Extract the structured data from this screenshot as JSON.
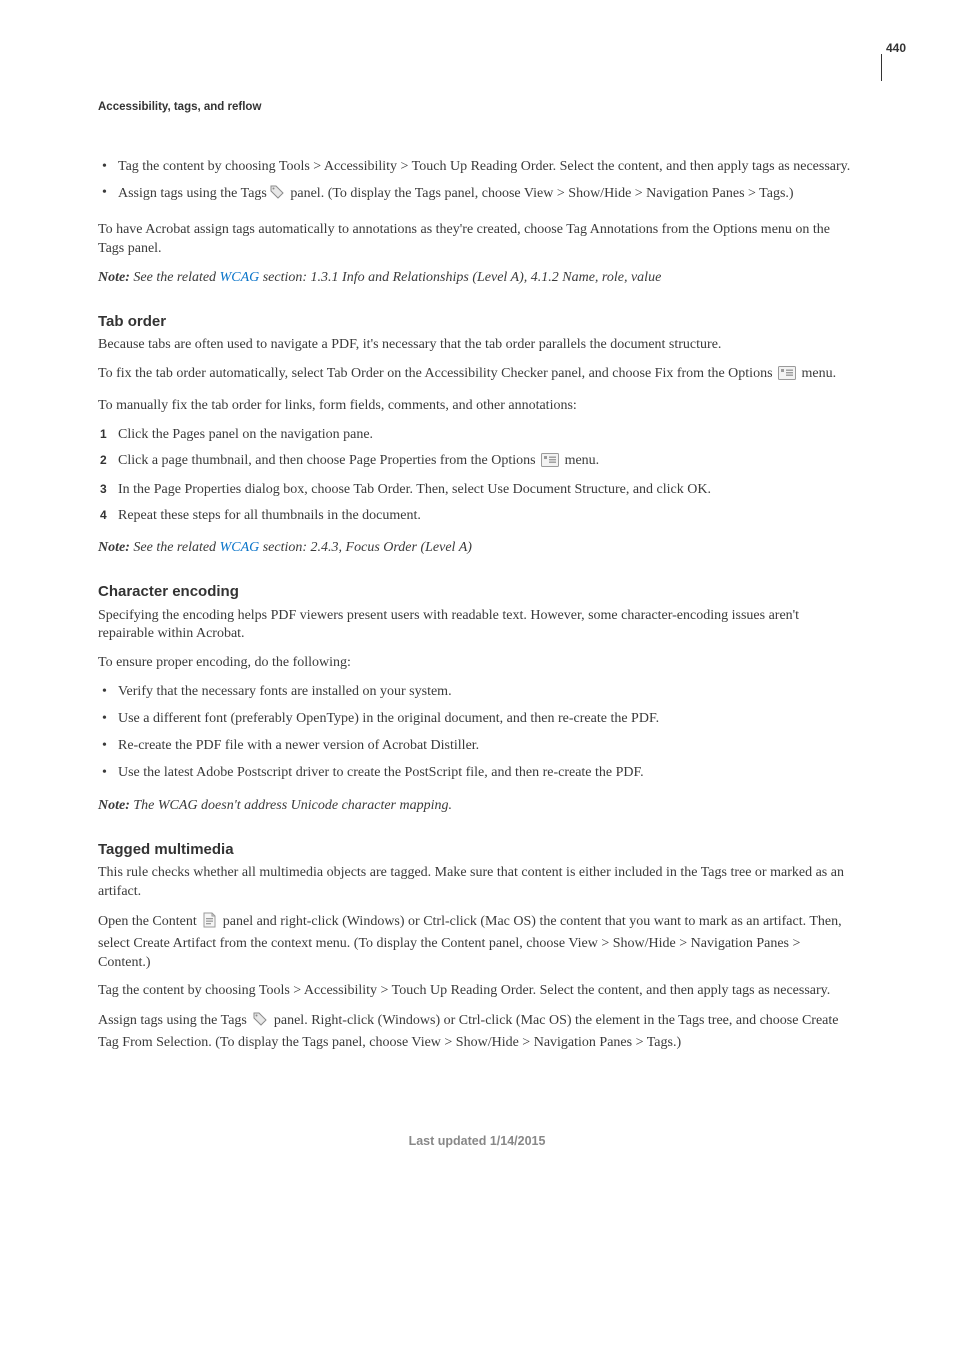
{
  "page_number": "440",
  "running_head": "Accessibility, tags, and reflow",
  "intro": {
    "bullets": [
      "Tag the content by choosing Tools > Accessibility > Touch Up Reading Order. Select the content, and then apply tags as necessary.",
      "Assign tags using the Tags  panel. (To display the Tags panel, choose View > Show/Hide > Navigation Panes > Tags.)"
    ],
    "para": "To have Acrobat assign tags automatically to annotations as they're created, choose Tag Annotations from the Options menu on the Tags panel.",
    "note_label": "Note:",
    "note_pre": " See the related ",
    "note_link": "WCAG",
    "note_post": " section: 1.3.1 Info and Relationships (Level A), 4.1.2 Name, role, value"
  },
  "tab_order": {
    "heading": "Tab order",
    "p1": "Because tabs are often used to navigate a PDF, it's necessary that the tab order parallels the document structure.",
    "p2a": "To fix the tab order automatically, select Tab Order on the Accessibility Checker panel, and choose Fix from the Options ",
    "p2b": " menu.",
    "p3": "To manually fix the tab order for links, form fields, comments, and other annotations:",
    "steps": {
      "s1": "Click the Pages panel on the navigation pane.",
      "s2a": "Click a page thumbnail, and then choose Page Properties from the Options ",
      "s2b": " menu.",
      "s3": "In the Page Properties dialog box, choose Tab Order. Then, select Use Document Structure, and click OK.",
      "s4": "Repeat these steps for all thumbnails in the document."
    },
    "note_label": "Note:",
    "note_pre": " See the related ",
    "note_link": "WCAG",
    "note_post": " section: 2.4.3, Focus Order (Level A)"
  },
  "char_enc": {
    "heading": "Character encoding",
    "p1": "Specifying the encoding helps PDF viewers present users with readable text. However, some character-encoding issues aren't repairable within Acrobat.",
    "p2": "To ensure proper encoding, do the following:",
    "bullets": [
      "Verify that the necessary fonts are installed on your system.",
      "Use a different font (preferably OpenType) in the original document, and then re-create the PDF.",
      "Re-create the PDF file with a newer version of Acrobat Distiller.",
      "Use the latest Adobe Postscript driver to create the PostScript file, and then re-create the PDF."
    ],
    "note_label": "Note:",
    "note_text": " The WCAG doesn't address Unicode character mapping."
  },
  "tagged_mm": {
    "heading": "Tagged multimedia",
    "p1": "This rule checks whether all multimedia objects are tagged. Make sure that content is either included in the Tags tree or marked as an artifact.",
    "p2a": "Open the Content ",
    "p2b": " panel and right-click (Windows) or Ctrl-click (Mac OS) the content that you want to mark as an artifact. Then, select Create Artifact from the context menu. (To display the Content panel, choose View > Show/Hide > Navigation Panes > Content.)",
    "p3": "Tag the content by choosing Tools > Accessibility > Touch Up Reading Order. Select the content, and then apply tags as necessary.",
    "p4a": "Assign tags using the Tags ",
    "p4b": " panel. Right-click (Windows) or Ctrl-click (Mac OS) the element in the Tags tree, and choose Create Tag From Selection. (To display the Tags panel, choose View > Show/Hide > Navigation Panes > Tags.)"
  },
  "footer": "Last updated 1/14/2015"
}
